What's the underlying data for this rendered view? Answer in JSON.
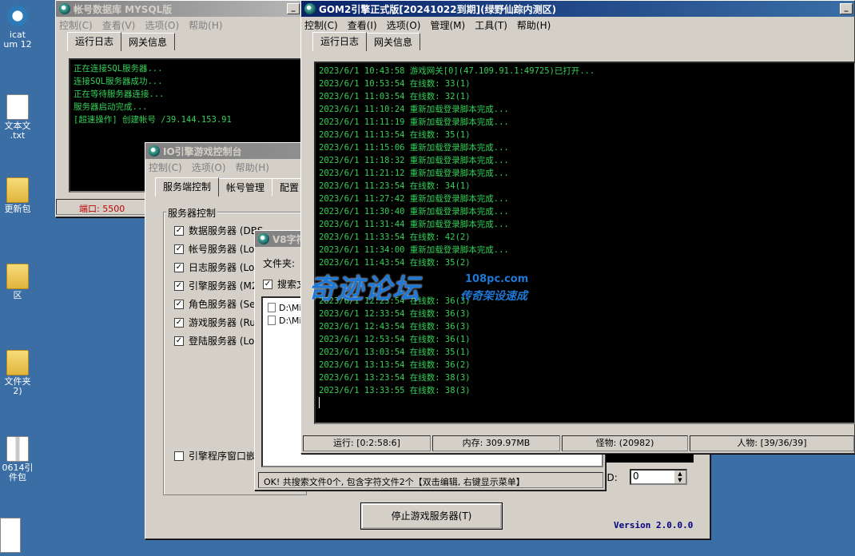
{
  "desktop": {
    "icons": [
      {
        "label": "icat\num 12"
      },
      {
        "label": "文本文\n.txt"
      },
      {
        "label": "更新包"
      },
      {
        "label": "区"
      },
      {
        "label": "文件夹\n2)"
      },
      {
        "label": "0614引\n件包"
      }
    ]
  },
  "db_window": {
    "title": "帐号数据库 MYSQL版",
    "menu": [
      "控制(C)",
      "查看(V)",
      "选项(O)",
      "帮助(H)"
    ],
    "tabs": [
      "运行日志",
      "网关信息"
    ],
    "log": [
      "正在连接SQL服务器...",
      "连接SQL服务器成功...",
      "正在等待服务器连接...",
      "服务器启动完成...",
      "[超速操作] 创建帐号 /39.144.153.91"
    ],
    "port": "端口: 5500"
  },
  "console_window": {
    "title": "IO引擎游戏控制台",
    "menu": [
      "控制(C)",
      "选项(O)",
      "帮助(H)"
    ],
    "tabs": [
      "服务端控制",
      "帐号管理",
      "配置"
    ],
    "group_title": "服务器控制",
    "servers": [
      {
        "label": "数据服务器 (DBS",
        "checked": true
      },
      {
        "label": "帐号服务器 (Lo",
        "checked": true
      },
      {
        "label": "日志服务器 (Lo",
        "checked": true
      },
      {
        "label": "引擎服务器 (M2S",
        "checked": true
      },
      {
        "label": "角色服务器 (Se",
        "checked": true
      },
      {
        "label": "游戏服务器 (Ru",
        "checked": true
      },
      {
        "label": "登陆服务器 (Lo",
        "checked": true
      }
    ],
    "embed_label": "引擎程序窗口嵌",
    "id_label": "ID:",
    "id_value": "0",
    "stop_button": "停止游戏服务器(T)",
    "version": "Version 2.0.0.0"
  },
  "font_window": {
    "title": "V8字符",
    "folder_label": "文件夹:",
    "search_label": "搜索文",
    "files": [
      "D:\\Mi",
      "D:\\Mi"
    ],
    "status": "OK! 共搜索文件0个, 包含字符文件2个【双击编辑, 右键显示菜单】"
  },
  "gom_window": {
    "title": "GOM2引擎正式版[20241022到期](绿野仙踪内测区)",
    "menu": [
      "控制(C)",
      "查看(I)",
      "选项(O)",
      "管理(M)",
      "工具(T)",
      "帮助(H)"
    ],
    "tabs": [
      "运行日志",
      "网关信息"
    ],
    "log": [
      "2023/6/1 10:43:58 游戏网关[0](47.109.91.1:49725)已打开...",
      "2023/6/1 10:53:54 在线数: 33(1)",
      "2023/6/1 11:03:54 在线数: 32(1)",
      "2023/6/1 11:10:24 重新加载登录脚本完成...",
      "2023/6/1 11:11:19 重新加载登录脚本完成...",
      "2023/6/1 11:13:54 在线数: 35(1)",
      "2023/6/1 11:15:06 重新加载登录脚本完成...",
      "2023/6/1 11:18:32 重新加载登录脚本完成...",
      "2023/6/1 11:21:12 重新加载登录脚本完成...",
      "2023/6/1 11:23:54 在线数: 34(1)",
      "2023/6/1 11:27:42 重新加载登录脚本完成...",
      "2023/6/1 11:30:40 重新加载登录脚本完成...",
      "2023/6/1 11:31:44 重新加载登录脚本完成...",
      "2023/6/1 11:33:54 在线数: 42(2)",
      "2023/6/1 11:34:00 重新加载登录脚本完成...",
      "2023/6/1 11:43:54 在线数: 35(2)",
      "",
      "",
      "2023/6/1 12:23:54 在线数: 36(3)",
      "2023/6/1 12:33:54 在线数: 36(3)",
      "2023/6/1 12:43:54 在线数: 36(3)",
      "2023/6/1 12:53:54 在线数: 36(1)",
      "2023/6/1 13:03:54 在线数: 35(1)",
      "2023/6/1 13:13:54 在线数: 36(2)",
      "2023/6/1 13:23:54 在线数: 38(3)",
      "2023/6/1 13:33:55 在线数: 38(3)"
    ],
    "status": {
      "run": "运行: [0:2:58:6]",
      "memory": "内存: 309.97MB",
      "monsters": "怪物: (20982)",
      "players": "人物: [39/36/39]"
    }
  },
  "watermark": {
    "main": "奇迹论坛",
    "url": "108pc.com",
    "sub": "传奇架设速成"
  },
  "colors": {
    "desktop": "#3a6ea5",
    "terminal_text": "#34d058",
    "title_active": "#0a246a",
    "port_text": "#c00000",
    "watermark": "#1e78d6"
  }
}
